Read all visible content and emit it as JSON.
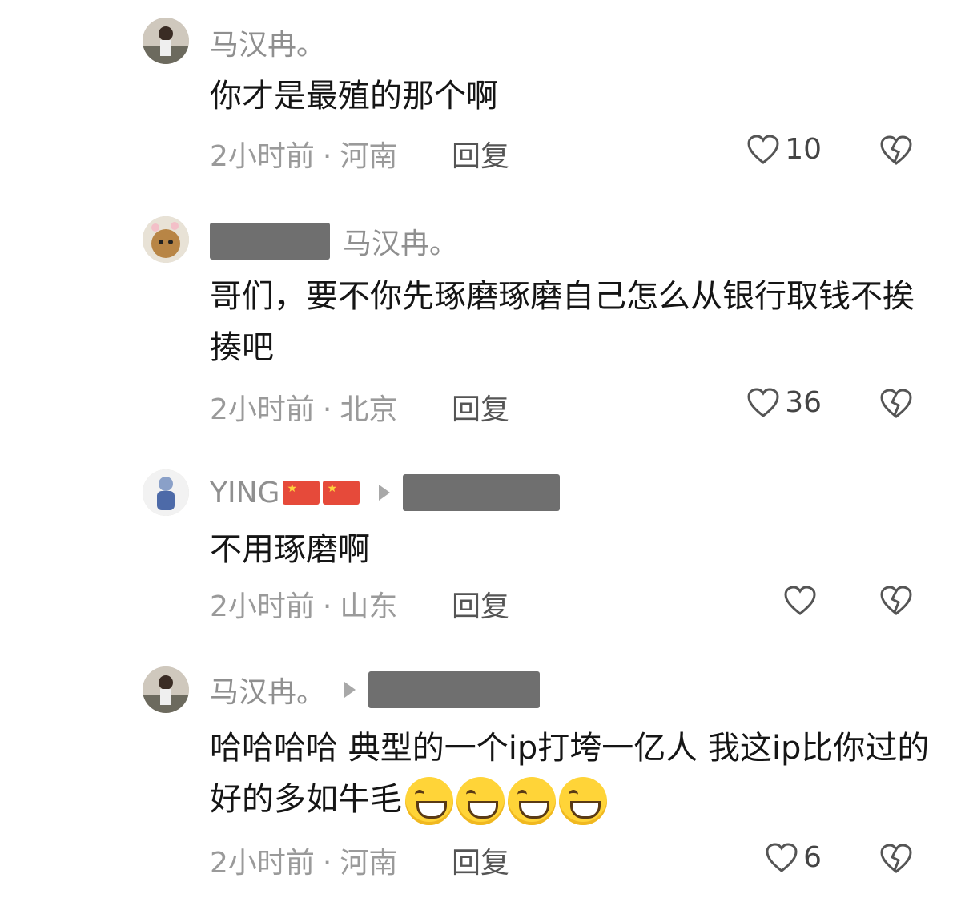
{
  "comments": [
    {
      "username": "马汉冉。",
      "text": "你才是最殖的那个啊",
      "time": "2小时前",
      "location": "河南",
      "reply_label": "回复",
      "likes": "10"
    },
    {
      "username": "马汉冉。",
      "text": "哥们，要不你先琢磨琢磨自己怎么从银行取钱不挨揍吧",
      "time": "2小时前",
      "location": "北京",
      "reply_label": "回复",
      "likes": "36"
    },
    {
      "username": "YING",
      "text": "不用琢磨啊",
      "time": "2小时前",
      "location": "山东",
      "reply_label": "回复",
      "likes": ""
    },
    {
      "username": "马汉冉。",
      "text": "哈哈哈哈 典型的一个ip打垮一亿人  我这ip比你过的好的多如牛毛",
      "time": "2小时前",
      "location": "河南",
      "reply_label": "回复",
      "likes": "6"
    }
  ],
  "separator": "·",
  "icons": {
    "like": "heart-outline-icon",
    "dislike": "broken-heart-icon",
    "reply_to": "triangle-right-icon"
  },
  "colors": {
    "text": "#151515",
    "muted": "#9a9a9a",
    "redaction": "#6f6f6f"
  }
}
